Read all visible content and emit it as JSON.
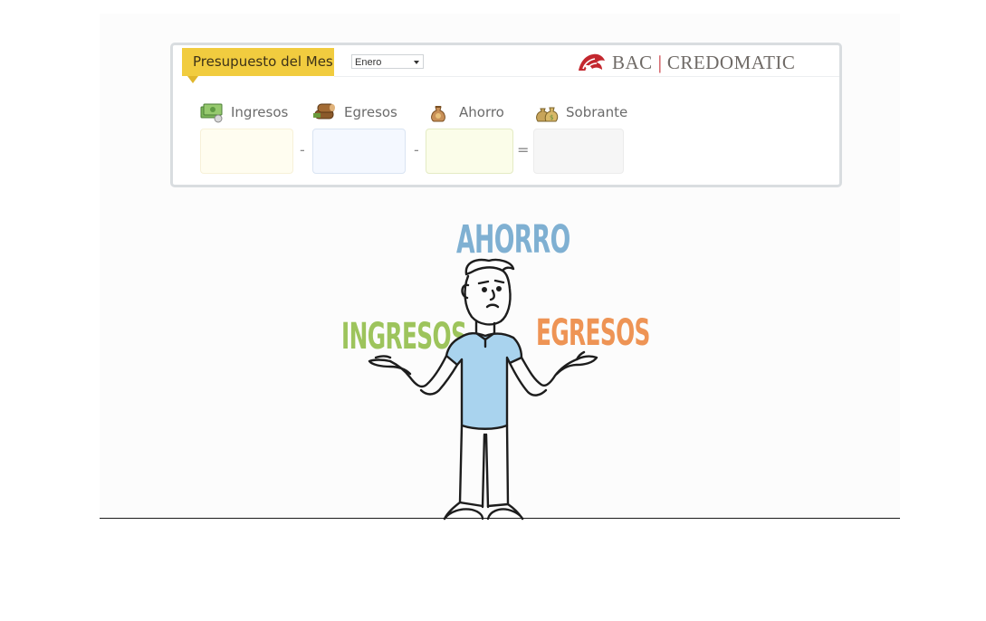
{
  "budget": {
    "tab_title": "Presupuesto del Mes",
    "month_select": {
      "value": "Enero"
    },
    "logo": {
      "brand1": "BAC",
      "separator": "|",
      "brand2": "CREDOMATIC"
    },
    "fields": [
      {
        "label": "Ingresos",
        "icon": "money-bills-icon",
        "value": "",
        "bg": "#fffdf0"
      },
      {
        "label": "Egresos",
        "icon": "logs-icon",
        "value": "",
        "bg": "#f4f8ff"
      },
      {
        "label": "Ahorro",
        "icon": "piggy-money-bag-icon",
        "value": "",
        "bg": "#fbfde9"
      },
      {
        "label": "Sobrante",
        "icon": "money-bags-icon",
        "value": "",
        "bg": "#f6f6f6"
      }
    ],
    "operators": [
      "-",
      "-",
      "="
    ]
  },
  "illustration": {
    "word_top": {
      "text": "AHORRO",
      "color": "#7fb0d2"
    },
    "word_left": {
      "text": "INGRESOS",
      "color": "#9dc45c"
    },
    "word_right": {
      "text": "EGRESOS",
      "color": "#ee9455"
    }
  },
  "colors": {
    "tab": "#f1cc3f",
    "logo_red": "#c3272e",
    "shirt": "#a9d3ee"
  }
}
